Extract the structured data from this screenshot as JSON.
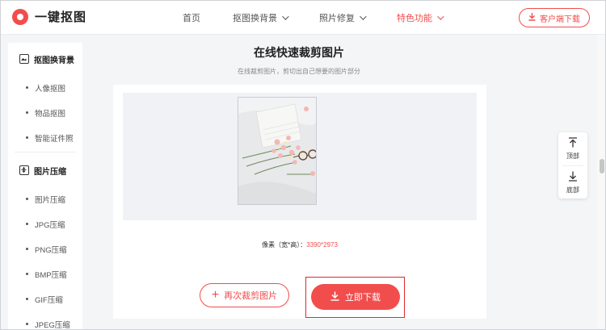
{
  "logo": {
    "text": "一键抠图"
  },
  "nav": {
    "items": [
      {
        "label": "首页",
        "has_dropdown": false,
        "active": false
      },
      {
        "label": "抠图换背景",
        "has_dropdown": true,
        "active": false
      },
      {
        "label": "照片修复",
        "has_dropdown": true,
        "active": false
      },
      {
        "label": "特色功能",
        "has_dropdown": true,
        "active": true
      }
    ],
    "client_download": "客户端下载"
  },
  "sidebar": {
    "sections": [
      {
        "title": "抠图换背景",
        "icon": "image-icon",
        "items": [
          "人像抠图",
          "物品抠图",
          "智能证件照"
        ]
      },
      {
        "title": "图片压缩",
        "icon": "compress-icon",
        "items": [
          "图片压缩",
          "JPG压缩",
          "PNG压缩",
          "BMP压缩",
          "GIF压缩",
          "JPEG压缩"
        ]
      }
    ]
  },
  "main": {
    "title": "在线快速裁剪图片",
    "subtitle": "在线裁剪图片，剪切出自己想要的图片部分",
    "pixel_label": "像素（宽*高）：",
    "pixel_value": "3390*2973",
    "recrop_label": "再次裁剪图片",
    "download_label": "立即下载"
  },
  "float_toolbar": {
    "top_label": "顶部",
    "bottom_label": "底部"
  },
  "colors": {
    "accent": "#f24d4d",
    "highlight_border": "#e0282c",
    "preview_bg": "#f0f2f6"
  }
}
